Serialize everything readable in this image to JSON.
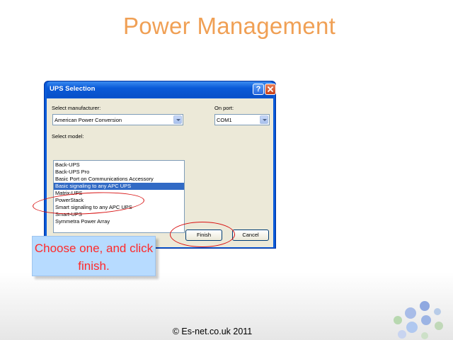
{
  "slide": {
    "title": "Power Management",
    "callout": "Choose one, and click finish.",
    "footer": "© Es-net.co.uk 2011"
  },
  "dialog": {
    "title": "UPS Selection",
    "help_label": "?",
    "close_label": "✕",
    "manufacturer_label": "Select manufacturer:",
    "manufacturer_value": "American Power Conversion",
    "port_label": "On port:",
    "port_value": "COM1",
    "model_label": "Select model:",
    "models": [
      "Back-UPS",
      "Back-UPS Pro",
      "Basic Port on Communications Accessory",
      "Basic signaling to any APC UPS",
      "Matrix-UPS",
      "PowerStack",
      "Smart signaling to any APC UPS",
      "Smart-UPS",
      "Symmetra Power Array"
    ],
    "selected_model": "Basic signaling to any APC UPS",
    "finish_label": "Finish",
    "cancel_label": "Cancel"
  },
  "colors": {
    "title": "#f0a055",
    "callout_bg": "#b7dbff",
    "callout_text": "#ff2a2a",
    "annotation": "#d81010",
    "selection": "#316ac5",
    "titlebar": "#0a5ad8"
  }
}
